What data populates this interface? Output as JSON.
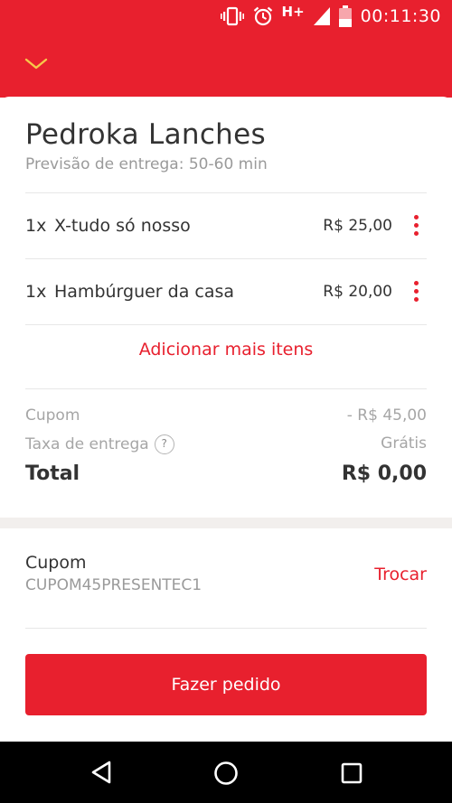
{
  "status_bar": {
    "network": "H+",
    "time": "00:11:30",
    "icons": [
      "vibrate-icon",
      "alarm-icon",
      "signal-icon",
      "battery-icon"
    ]
  },
  "header": {
    "back_icon": "chevron-down-icon",
    "color": "#e8202e"
  },
  "store": {
    "name": "Pedroka Lanches",
    "eta": "Previsão de entrega: 50-60 min"
  },
  "items": [
    {
      "qty": "1x",
      "name": "X-tudo só nosso",
      "price": "R$ 25,00"
    },
    {
      "qty": "1x",
      "name": "Hambúrguer da casa",
      "price": "R$ 20,00"
    }
  ],
  "add_more_label": "Adicionar mais itens",
  "summary": {
    "coupon_label": "Cupom",
    "coupon_value": "- R$ 45,00",
    "delivery_label": "Taxa de entrega",
    "delivery_help": "?",
    "delivery_value": "Grátis",
    "total_label": "Total",
    "total_value": "R$ 0,00"
  },
  "coupon": {
    "title": "Cupom",
    "code": "CUPOM45PRESENTEC1",
    "change_label": "Trocar"
  },
  "place_order_label": "Fazer pedido",
  "nav": {
    "icons": [
      "back-triangle-icon",
      "home-circle-icon",
      "recents-square-icon"
    ]
  }
}
